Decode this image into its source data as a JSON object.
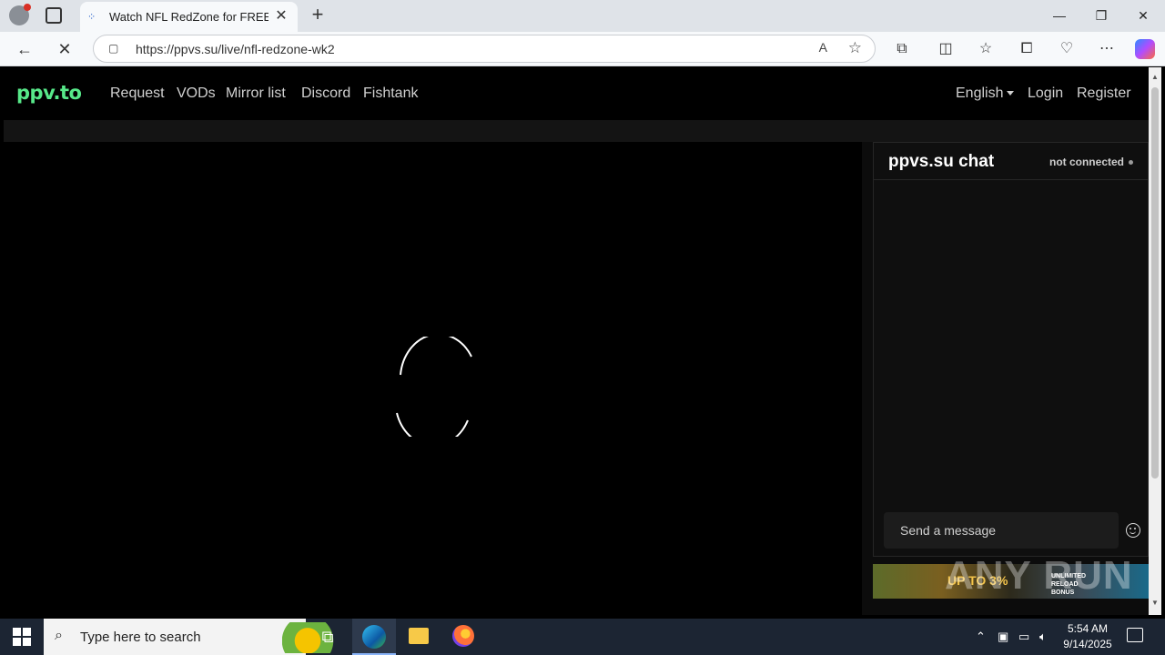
{
  "browser": {
    "tab_title": "Watch NFL RedZone for FREE on ppv.to",
    "url": "https://ppvs.su/live/nfl-redzone-wk2",
    "new_tab": "+",
    "tab_close": "✕",
    "minimize": "—",
    "restore": "❐",
    "close": "✕",
    "icons": [
      "back-icon",
      "stop-icon",
      "read-aloud-icon",
      "favorite-icon",
      "extensions-icon",
      "split-screen-icon",
      "favorites-icon",
      "collections-icon",
      "browser-essentials-icon",
      "more-icon",
      "copilot-icon"
    ]
  },
  "site": {
    "logo": "ppv.to",
    "nav": [
      "Request",
      "VODs",
      "Mirror list",
      "Discord",
      "Fishtank"
    ],
    "language": "English",
    "login": "Login",
    "register": "Register"
  },
  "chat": {
    "title": "ppvs.su chat",
    "status": "not connected",
    "placeholder": "Send a message"
  },
  "ad": {
    "headline": "UP TO 3%",
    "badge": "UNLIMITED RELOAD BONUS"
  },
  "watermark": "ANY RUN",
  "taskbar": {
    "search_placeholder": "Type here to search",
    "time": "5:54 AM",
    "date": "9/14/2025"
  },
  "colors": {
    "logo": "#57e889",
    "page_bg": "#000000",
    "nav_text": "#d0d0d0"
  }
}
